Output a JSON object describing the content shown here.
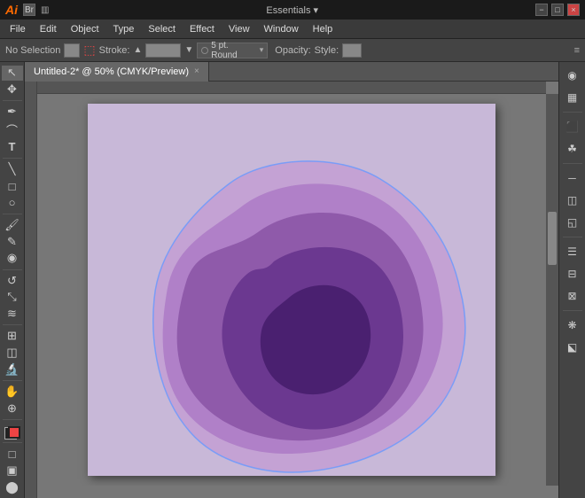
{
  "titlebar": {
    "app_name": "Ai",
    "br_label": "Br",
    "workspace_label": "Essentials ▾",
    "minimize": "−",
    "maximize": "□",
    "close": "×"
  },
  "menubar": {
    "items": [
      "File",
      "Edit",
      "Object",
      "Type",
      "Select",
      "Effect",
      "View",
      "Window",
      "Help"
    ]
  },
  "optionsbar": {
    "no_selection": "No Selection",
    "stroke_label": "Stroke:",
    "round_label": "5 pt. Round",
    "opacity_label": "Opacity:",
    "style_label": "Style:"
  },
  "tab": {
    "title": "Untitled-2* @ 50% (CMYK/Preview)",
    "close": "×"
  },
  "tools": {
    "list": [
      "↖",
      "✥",
      "✂",
      "⬡",
      "✒",
      "⌘",
      "T",
      "⬲",
      "◫",
      "⬜",
      "◎",
      "◈",
      "✎",
      "≋",
      "⊕",
      "☰",
      "↔",
      "⊙",
      "✱",
      "⌖",
      "☁",
      "⊞",
      "⊟",
      "⤡"
    ]
  },
  "rightpanel": {
    "tools": [
      "◉",
      "▦",
      "⬛",
      "☰",
      "◯",
      "▤",
      "≡",
      "⊠",
      "❋"
    ]
  },
  "colors": {
    "background": "#c8b8d8",
    "blob1": "#c4a8d4",
    "blob2": "#aa7ec0",
    "blob3": "#8b5faa",
    "blob4": "#6b3d8a",
    "blob5": "#4e2870"
  }
}
